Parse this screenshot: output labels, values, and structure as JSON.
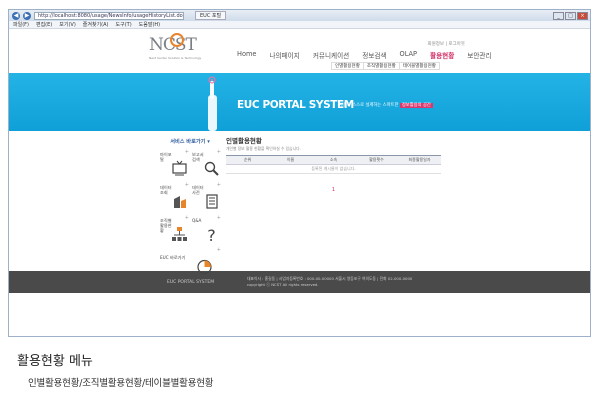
{
  "browser": {
    "address": "http://localhost:8080/usage/NewsInfo/usageHistoryList.do",
    "tab_title": "EUC 포털",
    "menu": [
      "파일(F)",
      "편집(E)",
      "보기(V)",
      "즐겨찾기(A)",
      "도구(T)",
      "도움말(H)"
    ],
    "back": "◀",
    "forward": "▶",
    "minimize": "_",
    "maximize": "□",
    "close": "×"
  },
  "site": {
    "logo_text": "NCST",
    "logo_sub": "Next Center Solution & Technology",
    "util_links": "회원정보 | 로그아웃",
    "nav": [
      "Home",
      "나의페이지",
      "커뮤니케이션",
      "정보검색",
      "OLAP",
      "활용현황",
      "보안관리"
    ],
    "active_nav": "활용현황",
    "subnav": [
      "인별활용현황",
      "조직별활용현황",
      "테이블별활용현황"
    ]
  },
  "banner": {
    "title": "EUC PORTAL SYSTEM",
    "subtitle": "사용자 스스로 설계하는 스마트한",
    "highlight": "정보활용의 공간"
  },
  "sidebar": {
    "header": "서비스 바로가기 ▾",
    "items": [
      {
        "label": "마이포탈",
        "icon": "tv-icon"
      },
      {
        "label": "보고서 검색",
        "icon": "search-icon"
      },
      {
        "label": "데이터 조회",
        "icon": "chart-icon"
      },
      {
        "label": "데이터 사전",
        "icon": "book-icon"
      },
      {
        "label": "조직별 활용현황",
        "icon": "org-chart-icon"
      },
      {
        "label": "Q&A",
        "icon": "question-icon"
      },
      {
        "label": "EUC 바로가기",
        "icon": "pie-chart-icon"
      }
    ]
  },
  "main": {
    "title": "인별활용현황",
    "desc": "개인별 정보 활용 현황을 확인하실 수 있습니다.",
    "columns": [
      "순위",
      "이름",
      "소속",
      "활용횟수",
      "최종활용일자"
    ],
    "empty_text": "등록된 게시물이 없습니다.",
    "page": "1"
  },
  "footer": {
    "left": "EUC PORTAL SYSTEM",
    "right_line1": "대표이사 : 홍길동 | 사업자등록번호 : 000-00-00000 서울시 영등포구 여의도동 | 전화 02-000-0000",
    "right_line2": "copyright ⓒ NCST All rights reserved."
  },
  "caption": {
    "title": "활용현황 메뉴",
    "subtitle": "인별활용현황/조직별활용현황/테이블별활용현황"
  },
  "colors": {
    "accent": "#d22f66",
    "banner": "#1aa9e0",
    "footer": "#4a4a4a"
  }
}
